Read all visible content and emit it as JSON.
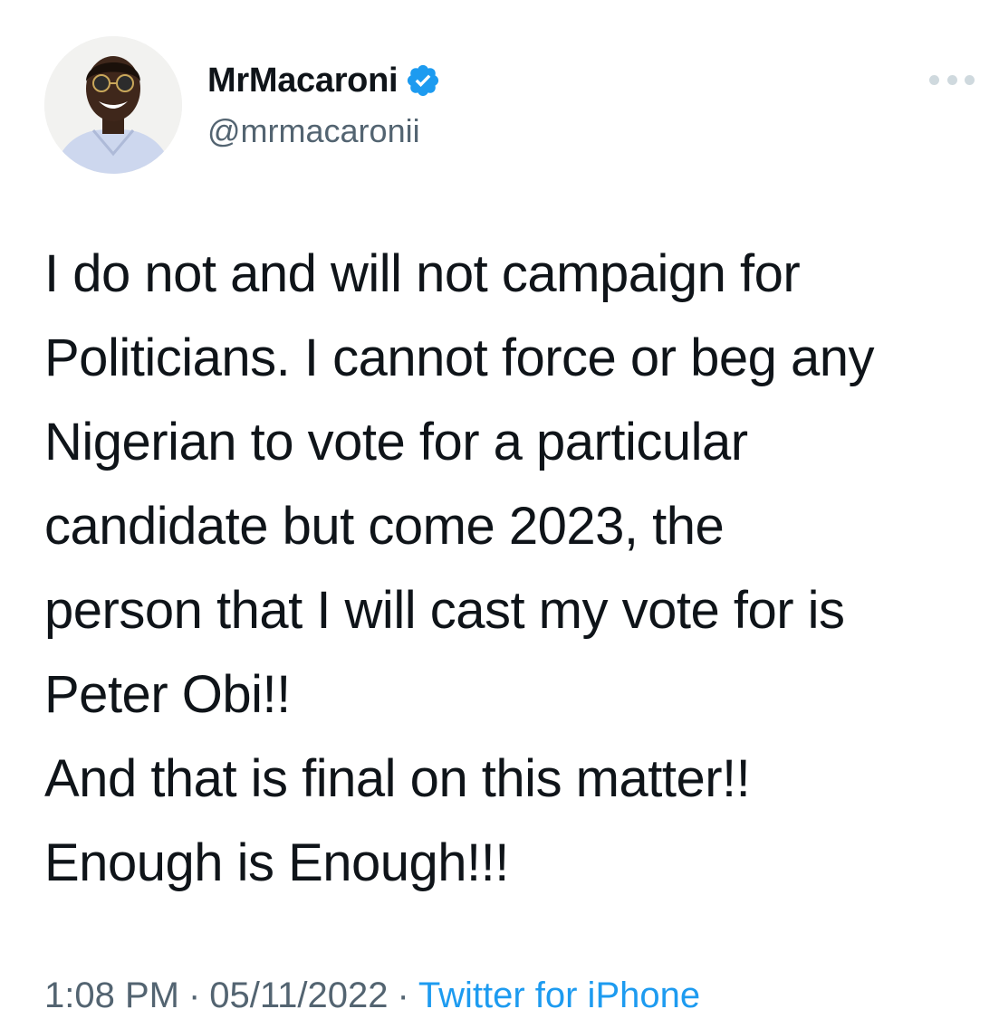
{
  "author": {
    "display_name": "MrMacaroni",
    "handle": "@mrmacaronii",
    "verified": true
  },
  "tweet": {
    "lines": [
      "I do not and will not campaign for",
      "Politicians. I cannot force or beg any",
      "Nigerian to vote for a particular",
      "candidate but come 2023, the",
      "person that I will cast my vote for is",
      "Peter Obi!!",
      "And that is final on this matter!!",
      "Enough is Enough!!!"
    ]
  },
  "meta": {
    "time": "1:08 PM",
    "separator": "·",
    "date": "05/11/2022",
    "source": "Twitter for iPhone"
  },
  "colors": {
    "accent": "#1d9bf0",
    "text": "#0f1419",
    "secondary": "#536471",
    "more_dots": "#cfd9de"
  },
  "icons": {
    "verified": "verified-badge-icon",
    "more": "more-options-icon"
  }
}
